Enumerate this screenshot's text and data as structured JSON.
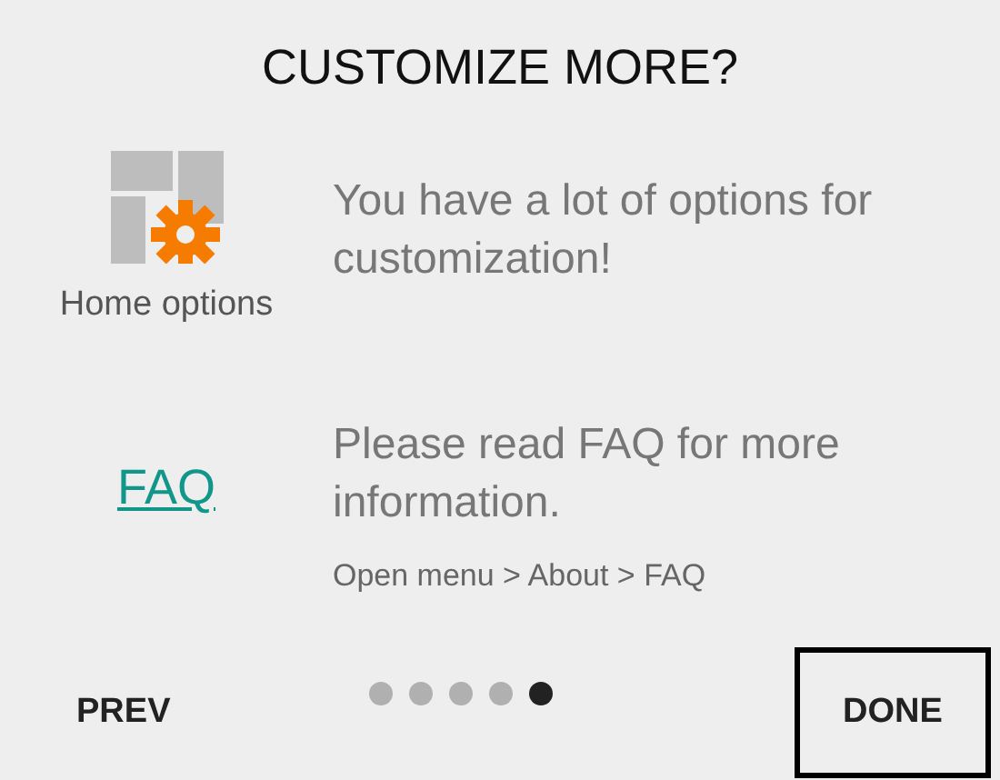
{
  "title": "CUSTOMIZE MORE?",
  "features": [
    {
      "kind": "icon",
      "label": "Home options",
      "text": "You have a lot of options for customization!"
    },
    {
      "kind": "link",
      "label": "FAQ",
      "text": "Please read FAQ for more information.",
      "note": "Open menu > About > FAQ"
    }
  ],
  "pager": {
    "prev": "PREV",
    "done": "DONE",
    "dots": [
      {
        "selected": false
      },
      {
        "selected": false
      },
      {
        "selected": false
      },
      {
        "selected": false
      },
      {
        "selected": true
      }
    ]
  }
}
